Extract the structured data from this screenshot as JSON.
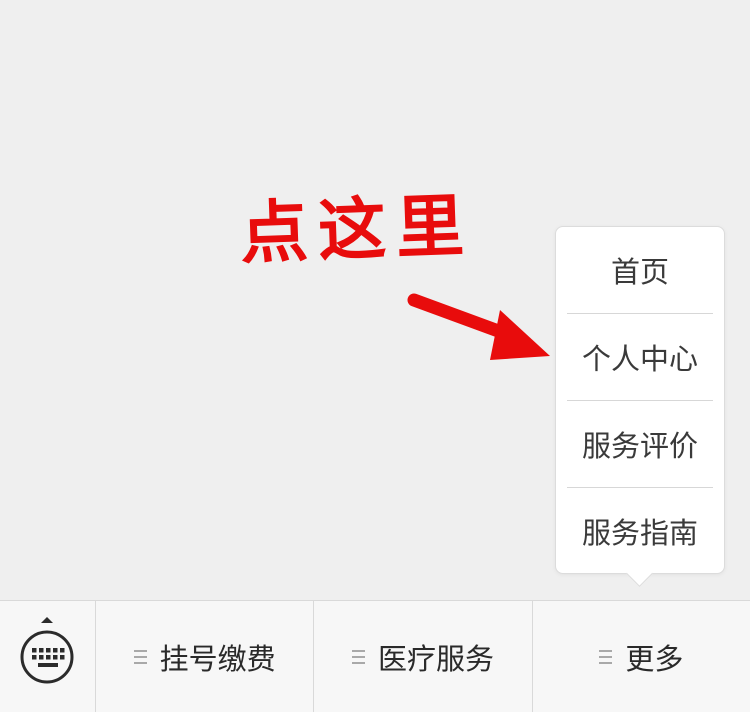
{
  "annotation": {
    "text": "点这里",
    "color": "#e80c0c",
    "arrow_icon": "arrow-right-down-icon"
  },
  "popup_menu": {
    "items": [
      {
        "label": "首页"
      },
      {
        "label": "个人中心"
      },
      {
        "label": "服务评价"
      },
      {
        "label": "服务指南"
      }
    ]
  },
  "bottom_bar": {
    "keyboard_icon": "keyboard-icon",
    "tabs": [
      {
        "label": "挂号缴费",
        "icon": "menu-icon"
      },
      {
        "label": "医疗服务",
        "icon": "menu-icon"
      },
      {
        "label": "更多",
        "icon": "menu-icon"
      }
    ]
  }
}
